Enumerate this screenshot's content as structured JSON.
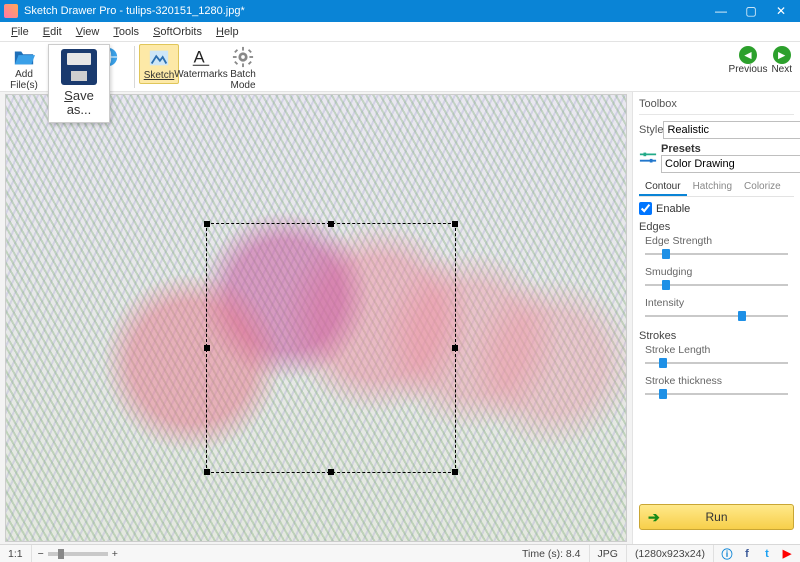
{
  "titlebar": {
    "title": "Sketch Drawer Pro - tulips-320151_1280.jpg*"
  },
  "menu": [
    "File",
    "Edit",
    "View",
    "Tools",
    "SoftOrbits",
    "Help"
  ],
  "toolbar": {
    "add_files": "Add File(s)",
    "save_as": "Save as",
    "sketch": "Sketch",
    "watermarks": "Watermarks",
    "batch_mode": "Batch Mode",
    "previous": "Previous",
    "next": "Next"
  },
  "saveas_popup": {
    "label": "Save as..."
  },
  "toolbox": {
    "title": "Toolbox",
    "style_label": "Style",
    "style_value": "Realistic",
    "presets_label": "Presets",
    "presets_value": "Color Drawing",
    "tabs": {
      "contour": "Contour",
      "hatching": "Hatching",
      "colorize": "Colorize"
    },
    "enable": "Enable",
    "edges_label": "Edges",
    "edge_strength": "Edge Strength",
    "smudging": "Smudging",
    "intensity": "Intensity",
    "strokes_label": "Strokes",
    "stroke_length": "Stroke Length",
    "stroke_thickness": "Stroke thickness",
    "run": "Run",
    "sliders": {
      "edge_strength": 12,
      "smudging": 12,
      "intensity": 65,
      "stroke_length": 10,
      "stroke_thickness": 10
    }
  },
  "status": {
    "zoom": "1:1",
    "time": "Time (s): 8.4",
    "format": "JPG",
    "dims": "(1280x923x24)"
  }
}
